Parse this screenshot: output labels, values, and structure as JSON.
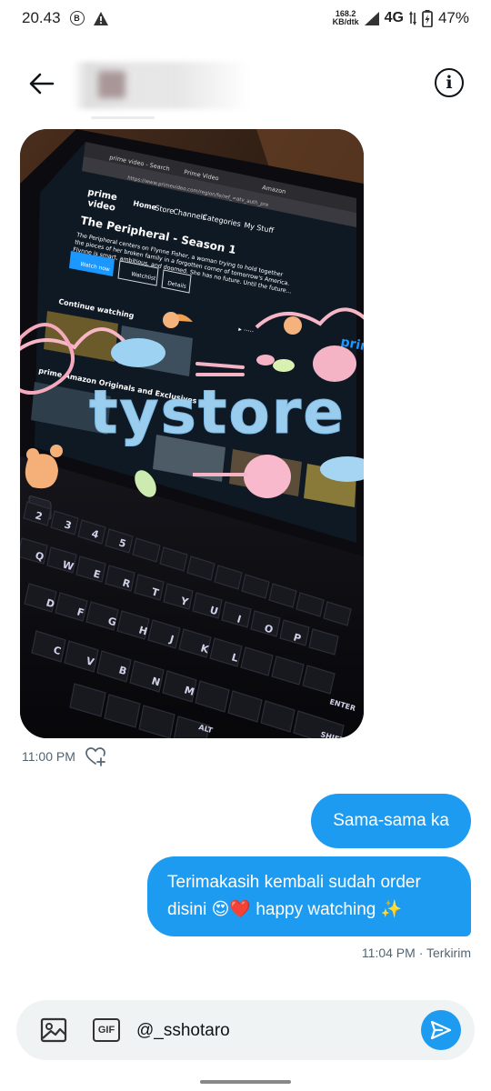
{
  "status_bar": {
    "time": "20.43",
    "notif_icon_letter": "B",
    "speed_value": "168.2",
    "speed_unit": "KB/dtk",
    "network_label": "4G",
    "battery": "47%"
  },
  "photo": {
    "browser": {
      "tab1": "prime video - Search",
      "tab2": "Prime Video",
      "tab3": "Amazon",
      "url": "https://www.primevideo.com/region/fe/ref_=atv_auth_pre"
    },
    "logo_top": "prime",
    "logo_bottom": "video",
    "nav": [
      "Home",
      "Store",
      "Channels",
      "Categories",
      "My Stuff"
    ],
    "show_title": "The Peripheral - Season 1",
    "description": [
      "The Peripheral centers on Flynne Fisher, a woman trying to hold together",
      "the pieces of her broken family in a forgotten corner of tomorrow's America.",
      "Flynne is smart, ambitious, and doomed. She has no future. Until the future..."
    ],
    "buttons": {
      "watch": "Watch now",
      "watchlist": "Watchlist",
      "details": "Details"
    },
    "row_label": "Continue watching",
    "row2_label": "prime Amazon Originals and Exclusives",
    "watermark": "tystore"
  },
  "received": {
    "time": "11:00 PM"
  },
  "sent": {
    "bubble1": "Sama-sama ka",
    "bubble2_line1": "Terimakasih kembali sudah order",
    "bubble2_line2": "disini 😍❤️ happy watching ✨",
    "time": "11:04 PM",
    "separator": "·",
    "status": "Terkirim"
  },
  "composer": {
    "gif_label": "GIF",
    "text": "@_sshotaro"
  },
  "colors": {
    "accent": "#1d9bf0",
    "composer_bg": "#eff3f4",
    "meta_text": "#536471"
  }
}
